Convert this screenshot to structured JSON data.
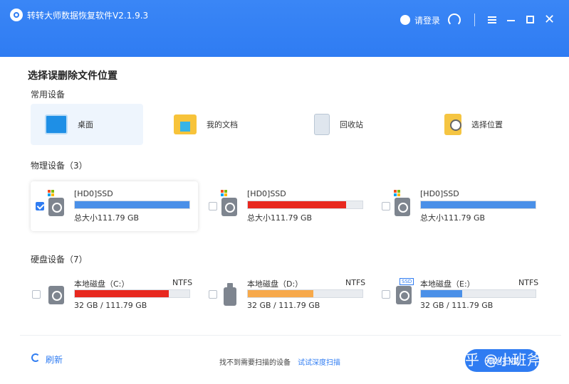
{
  "window": {
    "title": "转转大师数据恢复软件V2.1.9.3",
    "login_label": "请登录",
    "accent_color": "#2f7cf2"
  },
  "page": {
    "title": "选择误删除文件位置"
  },
  "common": {
    "label": "常用设备",
    "items": [
      {
        "label": "桌面",
        "icon": "desktop-icon",
        "selected": true
      },
      {
        "label": "我的文档",
        "icon": "folder-icon"
      },
      {
        "label": "回收站",
        "icon": "recycle-bin-icon"
      },
      {
        "label": "选择位置",
        "icon": "location-search-icon"
      }
    ]
  },
  "physical": {
    "label": "物理设备（3）",
    "items": [
      {
        "name": "[HD0]SSD",
        "size": "总大小111.79 GB",
        "checked": true,
        "fill_percent": 100,
        "color": "#4a90e8"
      },
      {
        "name": "[HD0]SSD",
        "size": "总大小111.79 GB",
        "checked": false,
        "fill_percent": 86,
        "color": "#e8281f"
      },
      {
        "name": "[HD0]SSD",
        "size": "总大小111.79 GB",
        "checked": false,
        "fill_percent": 100,
        "color": "#4a90e8"
      }
    ]
  },
  "disks": {
    "label": "硬盘设备（7）",
    "items": [
      {
        "name": "本地磁盘（C:）",
        "fs": "NTFS",
        "size": "32 GB / 111.79 GB",
        "fill_percent": 82,
        "color": "#e8281f",
        "icon": "hdd-icon"
      },
      {
        "name": "本地磁盘（D:）",
        "fs": "NTFS",
        "size": "32 GB / 111.79 GB",
        "fill_percent": 57,
        "color": "#f7a94a",
        "icon": "usb-drive-icon"
      },
      {
        "name": "本地磁盘（E:）",
        "fs": "NTFS",
        "size": "32 GB / 111.79 GB",
        "fill_percent": 36,
        "color": "#4a90e8",
        "icon": "ssd-drive-icon",
        "tag": "SSD"
      }
    ]
  },
  "footer": {
    "refresh_label": "刷新",
    "hint": "找不到需要扫描的设备",
    "deep_scan_link": "试试深度扫描",
    "next_label": "开始扫描"
  },
  "watermark": "知乎 @小班斧"
}
